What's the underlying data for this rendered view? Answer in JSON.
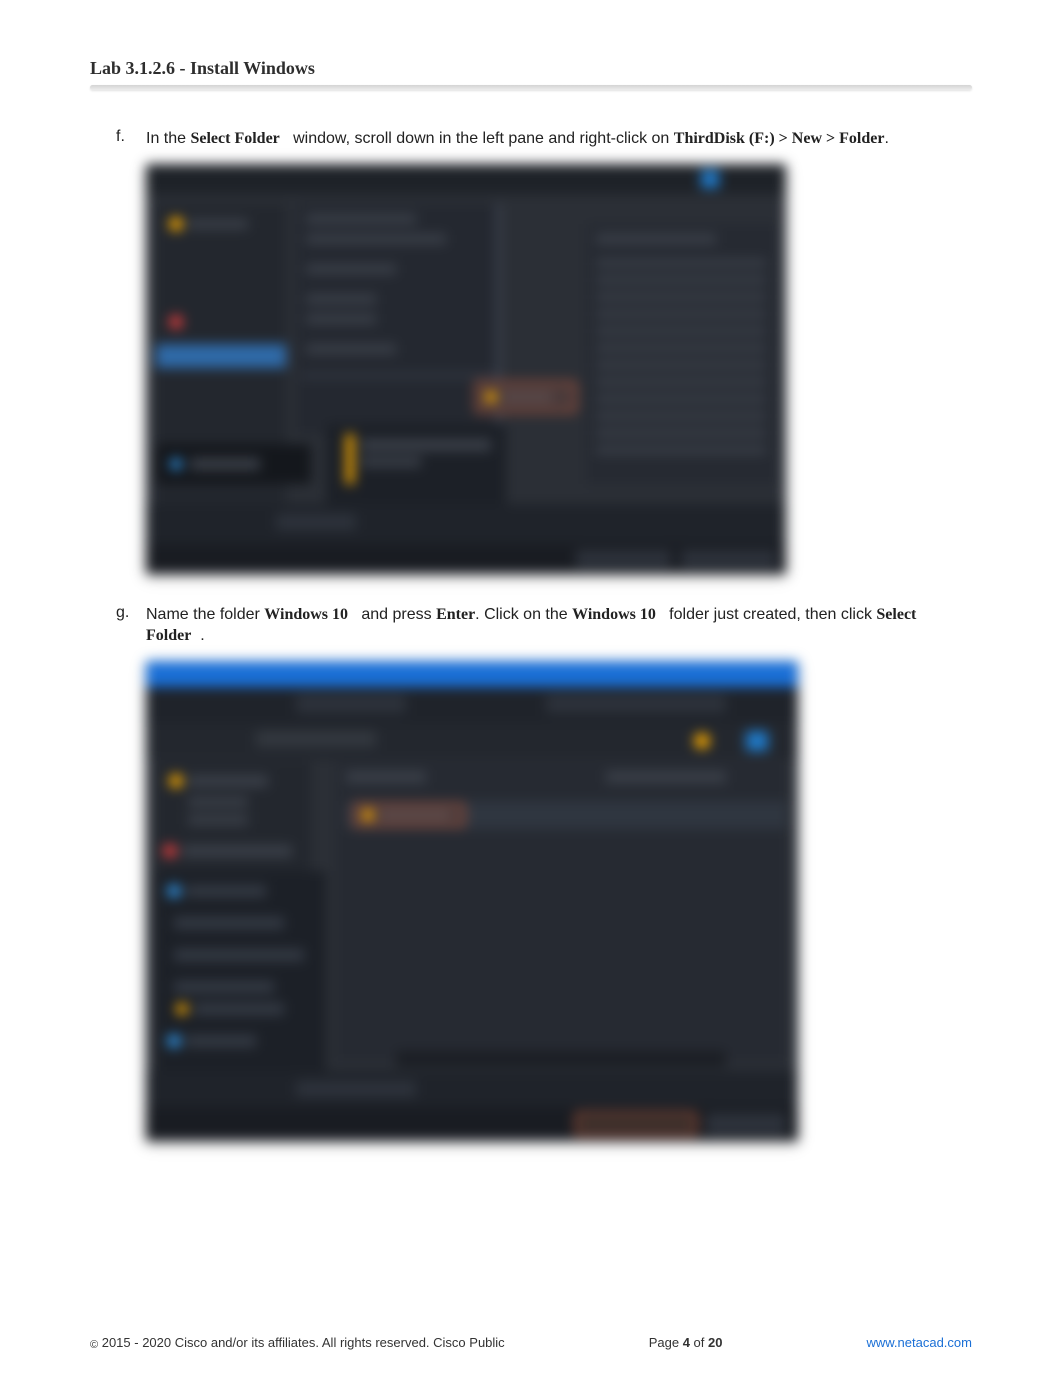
{
  "header": {
    "title": "Lab 3.1.2.6 - Install Windows"
  },
  "steps": {
    "f": {
      "letter": "f.",
      "pre": "In the ",
      "bold1": "Select Folder",
      "mid1": " window, scroll down in the left pane and right-click on ",
      "bold2": "ThirdDisk (F:) > New > Folder",
      "tail": "."
    },
    "g": {
      "letter": "g.",
      "pre": "Name the folder ",
      "bold1": "Windows 10",
      "mid1": " and press ",
      "bold2": "Enter",
      "mid2": ". Click on the ",
      "bold3": "Windows 10",
      "mid3": " folder just created, then click ",
      "bold4": "Select Folder",
      "tail": "."
    }
  },
  "footer": {
    "copyright_symbol": "©",
    "copyright": " 2015 - 2020 Cisco and/or its affiliates. All rights reserved. Cisco Public",
    "page_label_pre": "Page ",
    "page_current": "4",
    "page_of": " of ",
    "page_total": "20",
    "url": "www.netacad.com"
  }
}
